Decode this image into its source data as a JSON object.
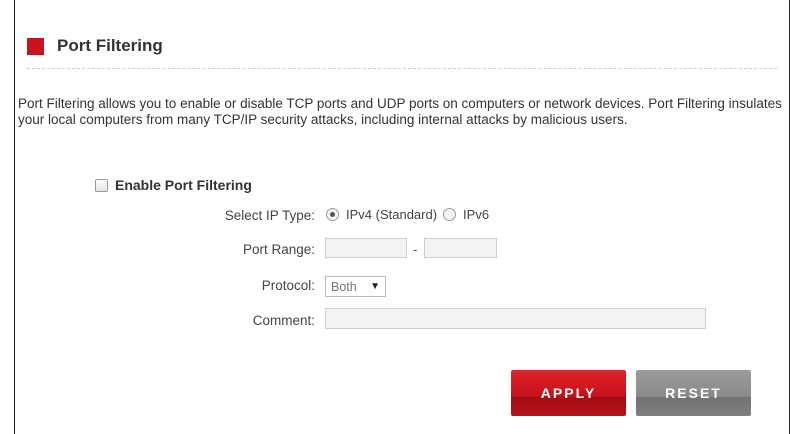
{
  "page": {
    "title": "Port Filtering",
    "description": "Port Filtering allows you to enable or disable TCP ports and UDP ports on computers or network devices. Port Filtering insulates your local computers from many TCP/IP security attacks, including internal attacks by malicious users."
  },
  "form": {
    "enable_label": "Enable Port Filtering",
    "enable_checked": false,
    "ip_type_label": "Select IP Type:",
    "ipv4_label": "IPv4  (Standard)",
    "ipv6_label": "IPv6",
    "ip_selected": "IPv4",
    "port_range_label": "Port Range:",
    "port_range_from": "",
    "port_range_to": "",
    "range_separator": "-",
    "protocol_label": "Protocol:",
    "protocol_value": "Both",
    "comment_label": "Comment:",
    "comment_value": ""
  },
  "buttons": {
    "apply": "APPLY",
    "reset": "RESET"
  },
  "colors": {
    "accent": "#c8141e",
    "reset": "#8a8a8a"
  }
}
